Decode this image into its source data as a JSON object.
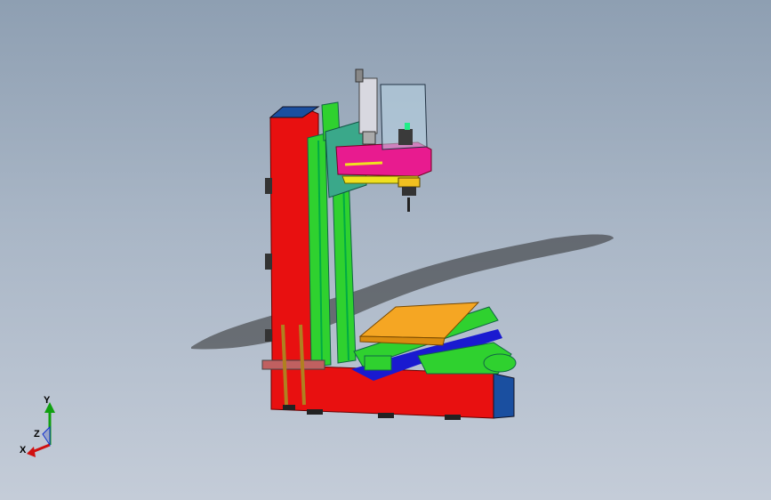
{
  "viewport": {
    "background_top": "#8e9fb2",
    "background_bottom": "#c4ccd8"
  },
  "model": {
    "colors": {
      "column": "#e81010",
      "column_top": "#1a4fa0",
      "rail": "#2fd12f",
      "head": "#e81b8f",
      "table_top": "#f5a623",
      "table_base": "#1a1ad0",
      "panel": "#3aa88a",
      "spindle_glass": "#b9d6e6"
    }
  },
  "triad": {
    "x_label": "X",
    "y_label": "Y",
    "z_label": "Z",
    "x_color": "#d01010",
    "y_color": "#10a010",
    "z_color": "#1030d0"
  }
}
